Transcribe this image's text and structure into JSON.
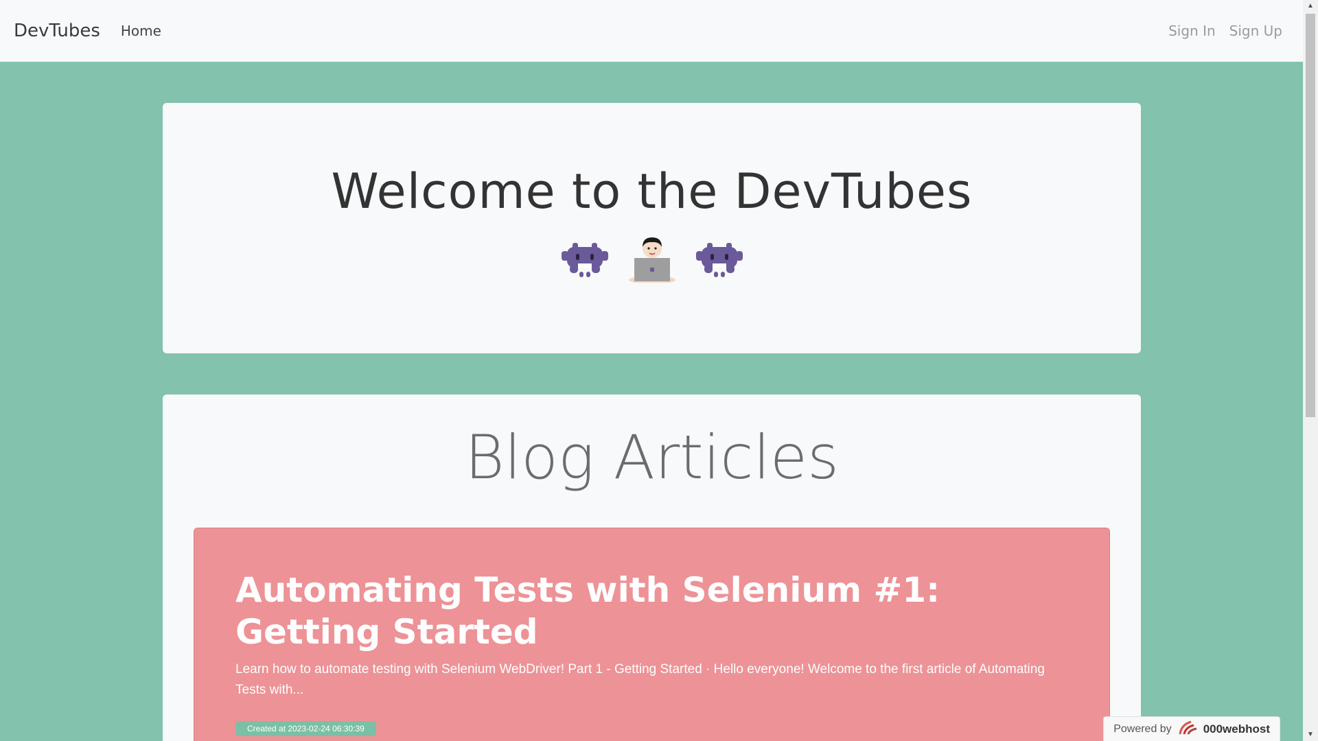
{
  "navbar": {
    "brand": "DevTubes",
    "home": "Home",
    "sign_in": "Sign In",
    "sign_up": "Sign Up"
  },
  "welcome": {
    "title": "Welcome to the DevTubes",
    "emojis": [
      "space-invader-icon",
      "technologist-icon",
      "space-invader-icon"
    ]
  },
  "blog": {
    "title": "Blog Articles",
    "articles": [
      {
        "title": "Automating Tests with Selenium #1: Getting Started",
        "excerpt": "Learn how to automate testing with Selenium WebDriver! Part 1 - Getting Started · Hello everyone! Welcome to the first article of Automating Tests with...",
        "created": "Created at 2023-02-24 06:30:39",
        "color": "#ed9296"
      }
    ]
  },
  "footer": {
    "powered_by": "Powered by",
    "host": "000webhost"
  },
  "colors": {
    "background": "#83c2ac",
    "card": "#f8f9fa",
    "article": "#ed9296",
    "badge": "#7ac0a6"
  }
}
